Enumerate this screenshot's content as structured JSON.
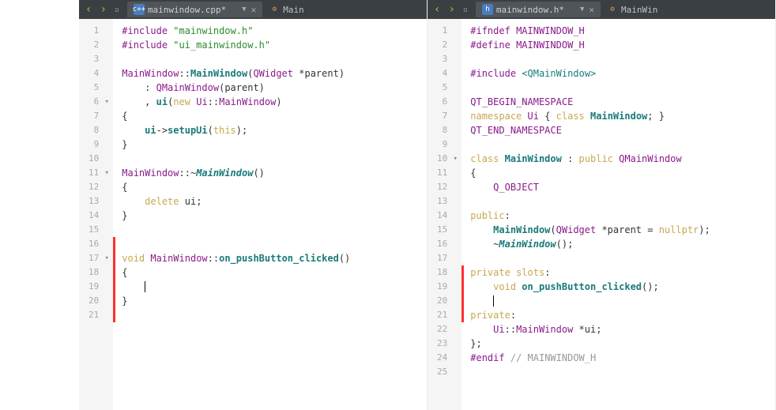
{
  "left": {
    "tab": "mainwindow.cpp*",
    "sidetab": "Main",
    "lines": 21,
    "folds": {
      "6": "▾",
      "11": "▾",
      "17": "▾"
    },
    "mods": [
      16,
      17,
      18,
      19,
      20,
      21
    ],
    "code_tokens": [
      [
        {
          "c": "pp",
          "t": "#include"
        },
        {
          "c": "",
          "t": " "
        },
        {
          "c": "str",
          "t": "\"mainwindow.h\""
        }
      ],
      [
        {
          "c": "pp",
          "t": "#include"
        },
        {
          "c": "",
          "t": " "
        },
        {
          "c": "str",
          "t": "\"ui_mainwindow.h\""
        }
      ],
      [],
      [
        {
          "c": "cls",
          "t": "MainWindow"
        },
        {
          "c": "",
          "t": "::"
        },
        {
          "c": "fn",
          "t": "MainWindow"
        },
        {
          "c": "",
          "t": "("
        },
        {
          "c": "cls",
          "t": "QWidget"
        },
        {
          "c": "",
          "t": " *parent)"
        }
      ],
      [
        {
          "c": "",
          "t": "    : "
        },
        {
          "c": "cls",
          "t": "QMainWindow"
        },
        {
          "c": "",
          "t": "(parent)"
        }
      ],
      [
        {
          "c": "",
          "t": "    , "
        },
        {
          "c": "fn",
          "t": "ui"
        },
        {
          "c": "",
          "t": "("
        },
        {
          "c": "kw",
          "t": "new"
        },
        {
          "c": "",
          "t": " "
        },
        {
          "c": "cls",
          "t": "Ui"
        },
        {
          "c": "",
          "t": "::"
        },
        {
          "c": "cls",
          "t": "MainWindow"
        },
        {
          "c": "",
          "t": ")"
        }
      ],
      [
        {
          "c": "",
          "t": "{"
        }
      ],
      [
        {
          "c": "",
          "t": "    "
        },
        {
          "c": "fn",
          "t": "ui"
        },
        {
          "c": "",
          "t": "->"
        },
        {
          "c": "fn",
          "t": "setupUi"
        },
        {
          "c": "",
          "t": "("
        },
        {
          "c": "kw",
          "t": "this"
        },
        {
          "c": "",
          "t": ");"
        }
      ],
      [
        {
          "c": "",
          "t": "}"
        }
      ],
      [],
      [
        {
          "c": "cls",
          "t": "MainWindow"
        },
        {
          "c": "",
          "t": "::~"
        },
        {
          "c": "fni",
          "t": "MainWindow"
        },
        {
          "c": "",
          "t": "()"
        }
      ],
      [
        {
          "c": "",
          "t": "{"
        }
      ],
      [
        {
          "c": "",
          "t": "    "
        },
        {
          "c": "kw",
          "t": "delete"
        },
        {
          "c": "",
          "t": " ui;"
        }
      ],
      [
        {
          "c": "",
          "t": "}"
        }
      ],
      [],
      [],
      [
        {
          "c": "kw",
          "t": "void"
        },
        {
          "c": "",
          "t": " "
        },
        {
          "c": "cls",
          "t": "MainWindow"
        },
        {
          "c": "",
          "t": "::"
        },
        {
          "c": "fn",
          "t": "on_pushButton_clicked"
        },
        {
          "c": "",
          "t": "()"
        }
      ],
      [
        {
          "c": "",
          "t": "{"
        }
      ],
      [
        {
          "c": "",
          "t": "    "
        },
        {
          "c": "cursor",
          "t": ""
        }
      ],
      [
        {
          "c": "",
          "t": "}"
        }
      ],
      []
    ]
  },
  "right": {
    "tab": "mainwindow.h*",
    "sidetab": "MainWin",
    "lines": 25,
    "folds": {
      "10": "▾"
    },
    "mods": [
      18,
      19,
      20,
      21
    ],
    "code_tokens": [
      [
        {
          "c": "pp",
          "t": "#ifndef"
        },
        {
          "c": "",
          "t": " "
        },
        {
          "c": "cls",
          "t": "MAINWINDOW_H"
        }
      ],
      [
        {
          "c": "pp",
          "t": "#define"
        },
        {
          "c": "",
          "t": " "
        },
        {
          "c": "cls",
          "t": "MAINWINDOW_H"
        }
      ],
      [],
      [
        {
          "c": "pp",
          "t": "#include"
        },
        {
          "c": "",
          "t": " "
        },
        {
          "c": "inc",
          "t": "<QMainWindow>"
        }
      ],
      [],
      [
        {
          "c": "cls",
          "t": "QT_BEGIN_NAMESPACE"
        }
      ],
      [
        {
          "c": "kw",
          "t": "namespace"
        },
        {
          "c": "",
          "t": " "
        },
        {
          "c": "cls",
          "t": "Ui"
        },
        {
          "c": "",
          "t": " { "
        },
        {
          "c": "kw",
          "t": "class"
        },
        {
          "c": "",
          "t": " "
        },
        {
          "c": "fn",
          "t": "MainWindow"
        },
        {
          "c": "",
          "t": "; }"
        }
      ],
      [
        {
          "c": "cls",
          "t": "QT_END_NAMESPACE"
        }
      ],
      [],
      [
        {
          "c": "kw",
          "t": "class"
        },
        {
          "c": "",
          "t": " "
        },
        {
          "c": "fn",
          "t": "MainWindow"
        },
        {
          "c": "",
          "t": " : "
        },
        {
          "c": "kw",
          "t": "public"
        },
        {
          "c": "",
          "t": " "
        },
        {
          "c": "cls",
          "t": "QMainWindow"
        }
      ],
      [
        {
          "c": "",
          "t": "{"
        }
      ],
      [
        {
          "c": "",
          "t": "    "
        },
        {
          "c": "cls",
          "t": "Q_OBJECT"
        }
      ],
      [],
      [
        {
          "c": "kw",
          "t": "public"
        },
        {
          "c": "",
          "t": ":"
        }
      ],
      [
        {
          "c": "",
          "t": "    "
        },
        {
          "c": "fn",
          "t": "MainWindow"
        },
        {
          "c": "",
          "t": "("
        },
        {
          "c": "cls",
          "t": "QWidget"
        },
        {
          "c": "",
          "t": " *parent = "
        },
        {
          "c": "kw",
          "t": "nullptr"
        },
        {
          "c": "",
          "t": ");"
        }
      ],
      [
        {
          "c": "",
          "t": "    ~"
        },
        {
          "c": "fni",
          "t": "MainWindow"
        },
        {
          "c": "",
          "t": "();"
        }
      ],
      [],
      [
        {
          "c": "kw",
          "t": "private"
        },
        {
          "c": "",
          "t": " "
        },
        {
          "c": "kw",
          "t": "slots"
        },
        {
          "c": "",
          "t": ":"
        }
      ],
      [
        {
          "c": "",
          "t": "    "
        },
        {
          "c": "kw",
          "t": "void"
        },
        {
          "c": "",
          "t": " "
        },
        {
          "c": "fn",
          "t": "on_pushButton_clicked"
        },
        {
          "c": "",
          "t": "();"
        }
      ],
      [
        {
          "c": "",
          "t": "    "
        },
        {
          "c": "cursor",
          "t": ""
        }
      ],
      [
        {
          "c": "kw",
          "t": "private"
        },
        {
          "c": "",
          "t": ":"
        }
      ],
      [
        {
          "c": "",
          "t": "    "
        },
        {
          "c": "cls",
          "t": "Ui"
        },
        {
          "c": "",
          "t": "::"
        },
        {
          "c": "cls",
          "t": "MainWindow"
        },
        {
          "c": "",
          "t": " *ui;"
        }
      ],
      [
        {
          "c": "",
          "t": "};"
        }
      ],
      [
        {
          "c": "pp",
          "t": "#endif"
        },
        {
          "c": "",
          "t": " "
        },
        {
          "c": "cmt",
          "t": "// MAINWINDOW_H"
        }
      ],
      []
    ]
  }
}
